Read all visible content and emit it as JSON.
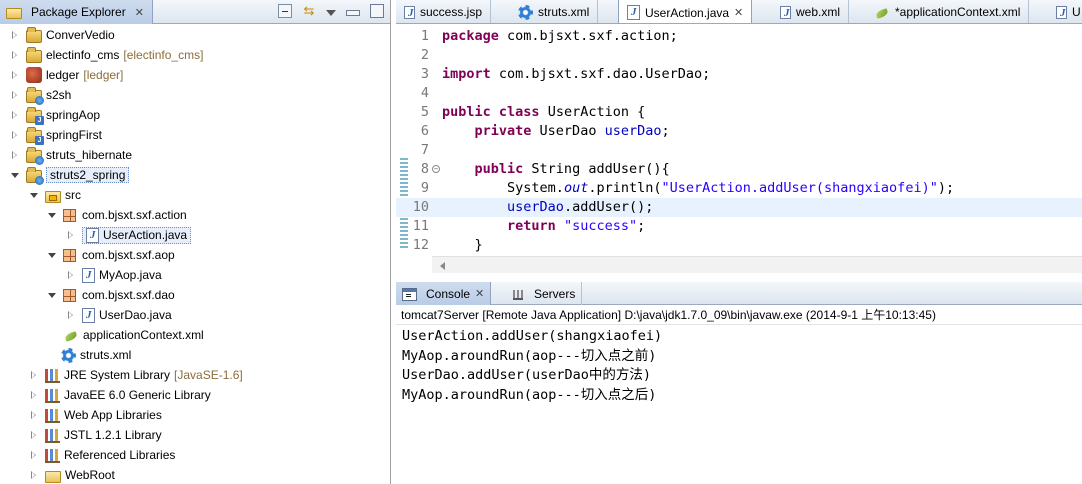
{
  "package_explorer": {
    "title": "Package Explorer",
    "nodes": [
      {
        "label": "ConverVedio",
        "decoration": "",
        "icon": "project-icon"
      },
      {
        "label": "electinfo_cms",
        "decoration": "[electinfo_cms]",
        "icon": "project-icon"
      },
      {
        "label": "ledger",
        "decoration": "[ledger]",
        "icon": "ledger-project-icon"
      },
      {
        "label": "s2sh",
        "decoration": "",
        "icon": "web-project-icon"
      },
      {
        "label": "springAop",
        "decoration": "",
        "icon": "java-project-icon"
      },
      {
        "label": "springFirst",
        "decoration": "",
        "icon": "java-project-icon"
      },
      {
        "label": "struts_hibernate",
        "decoration": "",
        "icon": "web-project-icon"
      },
      {
        "label": "struts2_spring",
        "decoration": "",
        "icon": "web-project-icon"
      },
      {
        "label": "src",
        "decoration": "",
        "icon": "source-folder-icon"
      },
      {
        "label": "com.bjsxt.sxf.action",
        "decoration": "",
        "icon": "package-icon"
      },
      {
        "label": "UserAction.java",
        "decoration": "",
        "icon": "java-file-icon"
      },
      {
        "label": "com.bjsxt.sxf.aop",
        "decoration": "",
        "icon": "package-icon"
      },
      {
        "label": "MyAop.java",
        "decoration": "",
        "icon": "java-file-icon"
      },
      {
        "label": "com.bjsxt.sxf.dao",
        "decoration": "",
        "icon": "package-icon"
      },
      {
        "label": "UserDao.java",
        "decoration": "",
        "icon": "java-file-icon"
      },
      {
        "label": "applicationContext.xml",
        "decoration": "",
        "icon": "spring-xml-icon"
      },
      {
        "label": "struts.xml",
        "decoration": "",
        "icon": "xml-config-icon"
      },
      {
        "label": "JRE System Library",
        "decoration": "[JavaSE-1.6]",
        "icon": "library-icon"
      },
      {
        "label": "JavaEE 6.0 Generic Library",
        "decoration": "",
        "icon": "library-icon"
      },
      {
        "label": "Web App Libraries",
        "decoration": "",
        "icon": "library-icon"
      },
      {
        "label": "JSTL 1.2.1 Library",
        "decoration": "",
        "icon": "library-icon"
      },
      {
        "label": "Referenced Libraries",
        "decoration": "",
        "icon": "library-icon"
      },
      {
        "label": "WebRoot",
        "decoration": "",
        "icon": "folder-icon"
      }
    ]
  },
  "editor": {
    "tabs": [
      {
        "label": "success.jsp",
        "icon": "jsp-file-icon"
      },
      {
        "label": "struts.xml",
        "icon": "xml-config-icon"
      },
      {
        "label": "UserAction.java",
        "icon": "java-file-icon",
        "active": true
      },
      {
        "label": "web.xml",
        "icon": "xml-file-icon"
      },
      {
        "label": "*applicationContext.xml",
        "icon": "spring-xml-icon"
      },
      {
        "label": "U",
        "icon": "java-file-icon"
      }
    ],
    "line_numbers": [
      "1",
      "2",
      "3",
      "4",
      "5",
      "6",
      "7",
      "8",
      "9",
      "10",
      "11",
      "12"
    ],
    "code": {
      "l1_kw": "package",
      "l1_rest": " com.bjsxt.sxf.action;",
      "l3_kw": "import",
      "l3_rest": " com.bjsxt.sxf.dao.UserDao;",
      "l5_kw1": "public",
      "l5_kw2": "class",
      "l5_rest": " UserAction {",
      "l6_kw": "private",
      "l6_type": " UserDao ",
      "l6_field": "userDao",
      "l6_end": ";",
      "l8_kw": "public",
      "l8_rest": " String addUser(){",
      "l9_a": "System.",
      "l9_out": "out",
      "l9_b": ".println(",
      "l9_str": "\"UserAction.addUser(shangxiaofei)\"",
      "l9_end": ");",
      "l10_field": "userDao",
      "l10_rest": ".addUser();",
      "l11_kw": "return",
      "l11_str": "\"success\"",
      "l11_end": ";",
      "l12": "}"
    }
  },
  "console": {
    "tabs": [
      {
        "label": "Console",
        "icon": "console-icon",
        "active": true
      },
      {
        "label": "Servers",
        "icon": "servers-icon"
      }
    ],
    "process_title": "tomcat7Server [Remote Java Application] D:\\java\\jdk1.7.0_09\\bin\\javaw.exe (2014-9-1 上午10:13:45)",
    "output": [
      "UserAction.addUser(shangxiaofei)",
      "MyAop.aroundRun(aop---切入点之前)",
      "UserDao.addUser(userDao中的方法)",
      "MyAop.aroundRun(aop---切入点之后)"
    ]
  }
}
